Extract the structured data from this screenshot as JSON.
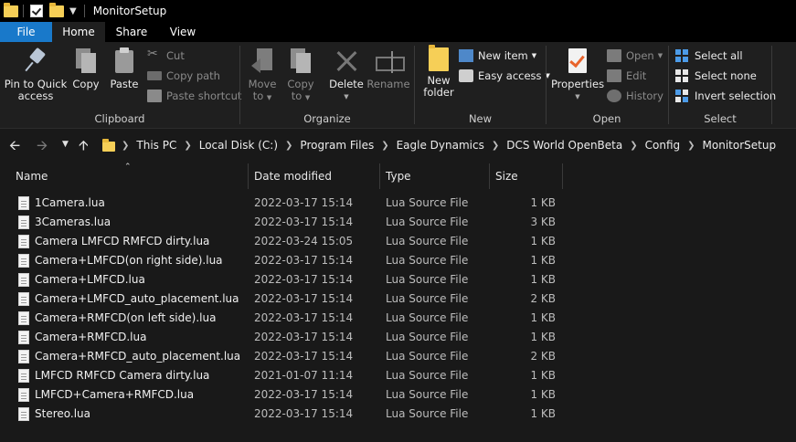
{
  "window": {
    "title": "MonitorSetup"
  },
  "tabs": [
    {
      "label": "File"
    },
    {
      "label": "Home"
    },
    {
      "label": "Share"
    },
    {
      "label": "View"
    }
  ],
  "ribbon": {
    "clipboard": {
      "label": "Clipboard",
      "pin": "Pin to Quick",
      "pin2": "access",
      "copy": "Copy",
      "paste": "Paste",
      "cut": "Cut",
      "copy_path": "Copy path",
      "paste_shortcut": "Paste shortcut"
    },
    "organize": {
      "label": "Organize",
      "move": "Move",
      "move2": "to",
      "copy": "Copy",
      "copy2": "to",
      "delete": "Delete",
      "rename": "Rename"
    },
    "new": {
      "label": "New",
      "new_folder": "New",
      "new_folder2": "folder",
      "new_item": "New item",
      "easy_access": "Easy access"
    },
    "open": {
      "label": "Open",
      "properties": "Properties",
      "open": "Open",
      "edit": "Edit",
      "history": "History"
    },
    "select": {
      "label": "Select",
      "select_all": "Select all",
      "select_none": "Select none",
      "invert": "Invert selection"
    }
  },
  "breadcrumb": [
    "This PC",
    "Local Disk (C:)",
    "Program Files",
    "Eagle Dynamics",
    "DCS World OpenBeta",
    "Config",
    "MonitorSetup"
  ],
  "columns": {
    "name": "Name",
    "date": "Date modified",
    "type": "Type",
    "size": "Size"
  },
  "files": [
    {
      "name": "1Camera.lua",
      "date": "2022-03-17 15:14",
      "type": "Lua Source File",
      "size": "1 KB"
    },
    {
      "name": "3Cameras.lua",
      "date": "2022-03-17 15:14",
      "type": "Lua Source File",
      "size": "3 KB"
    },
    {
      "name": "Camera LMFCD RMFCD dirty.lua",
      "date": "2022-03-24 15:05",
      "type": "Lua Source File",
      "size": "1 KB"
    },
    {
      "name": "Camera+LMFCD(on right side).lua",
      "date": "2022-03-17 15:14",
      "type": "Lua Source File",
      "size": "1 KB"
    },
    {
      "name": "Camera+LMFCD.lua",
      "date": "2022-03-17 15:14",
      "type": "Lua Source File",
      "size": "1 KB"
    },
    {
      "name": "Camera+LMFCD_auto_placement.lua",
      "date": "2022-03-17 15:14",
      "type": "Lua Source File",
      "size": "2 KB"
    },
    {
      "name": "Camera+RMFCD(on left side).lua",
      "date": "2022-03-17 15:14",
      "type": "Lua Source File",
      "size": "1 KB"
    },
    {
      "name": "Camera+RMFCD.lua",
      "date": "2022-03-17 15:14",
      "type": "Lua Source File",
      "size": "1 KB"
    },
    {
      "name": "Camera+RMFCD_auto_placement.lua",
      "date": "2022-03-17 15:14",
      "type": "Lua Source File",
      "size": "2 KB"
    },
    {
      "name": "LMFCD RMFCD Camera dirty.lua",
      "date": "2021-01-07 11:14",
      "type": "Lua Source File",
      "size": "1 KB"
    },
    {
      "name": "LMFCD+Camera+RMFCD.lua",
      "date": "2022-03-17 15:14",
      "type": "Lua Source File",
      "size": "1 KB"
    },
    {
      "name": "Stereo.lua",
      "date": "2022-03-17 15:14",
      "type": "Lua Source File",
      "size": "1 KB"
    }
  ]
}
